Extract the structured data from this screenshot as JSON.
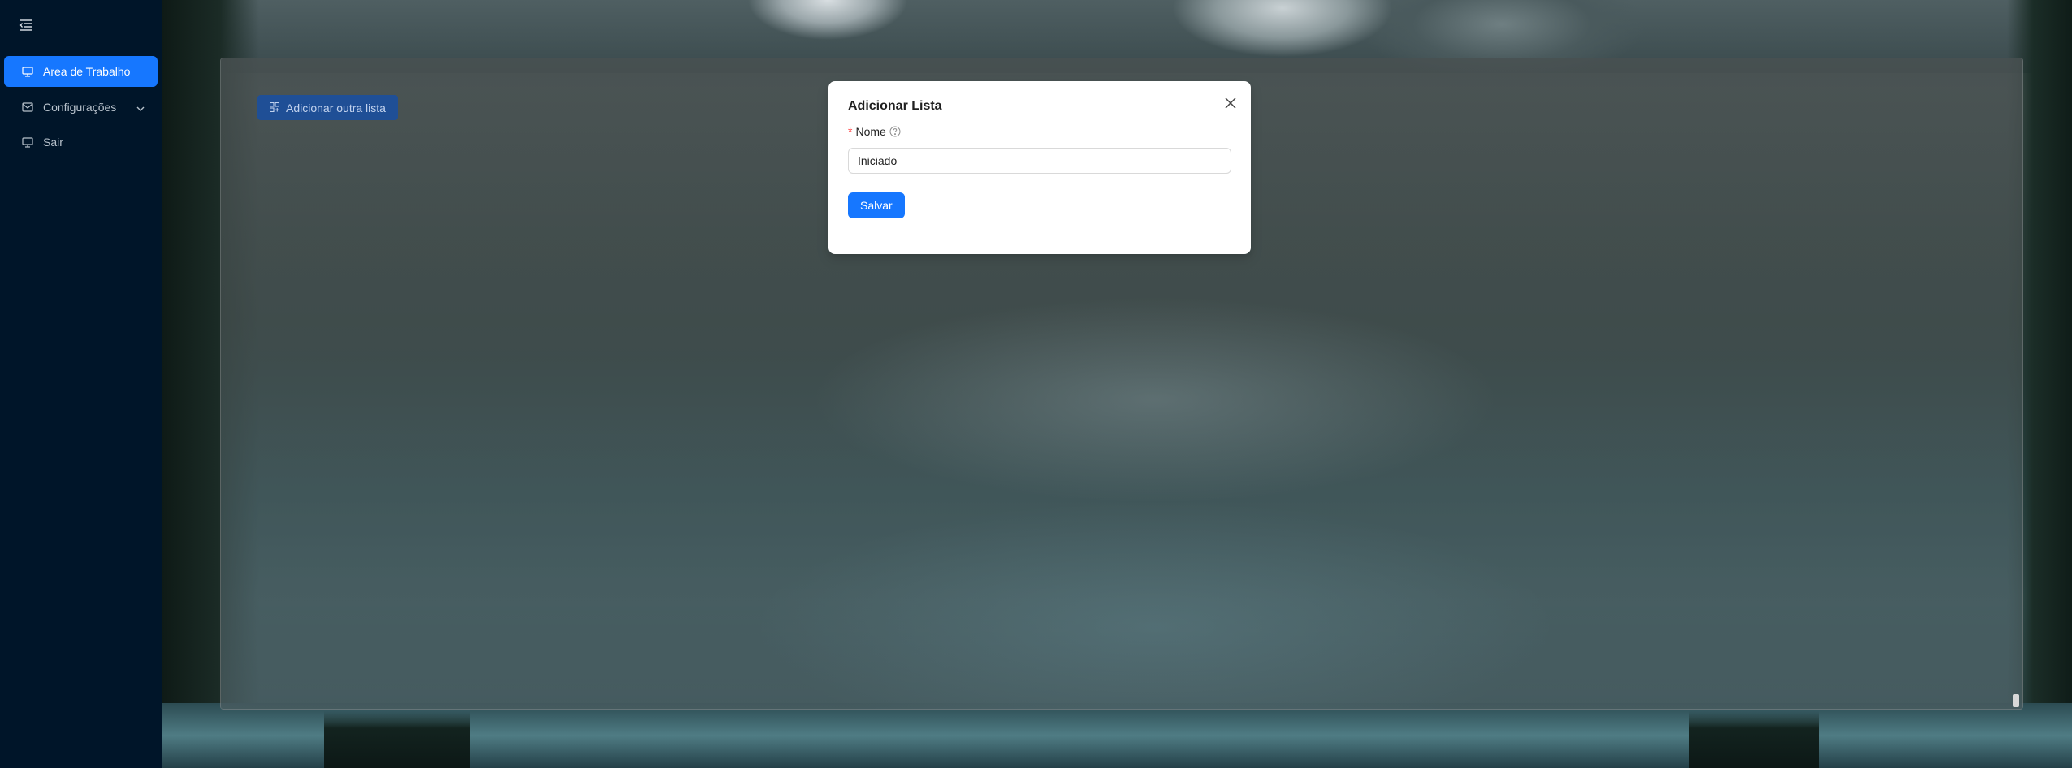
{
  "sidebar": {
    "items": [
      {
        "label": "Area de Trabalho",
        "icon": "desktop-icon",
        "active": true
      },
      {
        "label": "Configurações",
        "icon": "mail-icon",
        "expandable": true
      },
      {
        "label": "Sair",
        "icon": "desktop-icon"
      }
    ]
  },
  "content": {
    "add_list_label": "Adicionar outra lista"
  },
  "modal": {
    "title": "Adicionar Lista",
    "field_label": "Nome",
    "field_required_mark": "*",
    "field_value": "Iniciado",
    "save_label": "Salvar"
  },
  "colors": {
    "sidebar_bg": "#001529",
    "primary": "#1677ff",
    "required": "#ff4d4f"
  }
}
